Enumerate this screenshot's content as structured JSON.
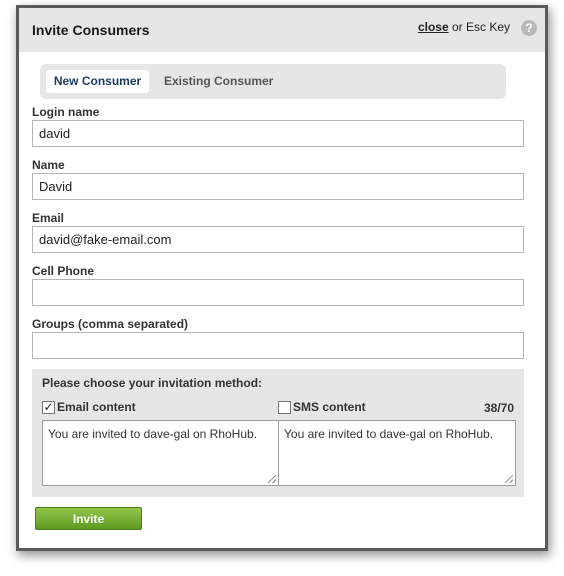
{
  "dialog": {
    "title": "Invite Consumers",
    "close_label": "close",
    "close_suffix": " or Esc Key",
    "help_glyph": "?"
  },
  "tabs": [
    {
      "label": "New Consumer",
      "active": true
    },
    {
      "label": "Existing Consumer",
      "active": false
    }
  ],
  "form": {
    "login_label": "Login name",
    "login_value": "david",
    "name_label": "Name",
    "name_value": "David",
    "email_label": "Email",
    "email_value": "david@fake-email.com",
    "cell_label": "Cell Phone",
    "cell_value": "",
    "groups_label": "Groups (comma separated)",
    "groups_value": ""
  },
  "invitation": {
    "title": "Please choose your invitation method:",
    "email_label": "Email content",
    "email_checked": true,
    "sms_label": "SMS content",
    "sms_checked": false,
    "sms_counter": "38/70",
    "email_content": "You are invited to dave-gal on RhoHub.",
    "sms_content": "You are invited to dave-gal on RhoHub."
  },
  "actions": {
    "invite_label": "Invite",
    "invite_color": "#6ea82b"
  }
}
